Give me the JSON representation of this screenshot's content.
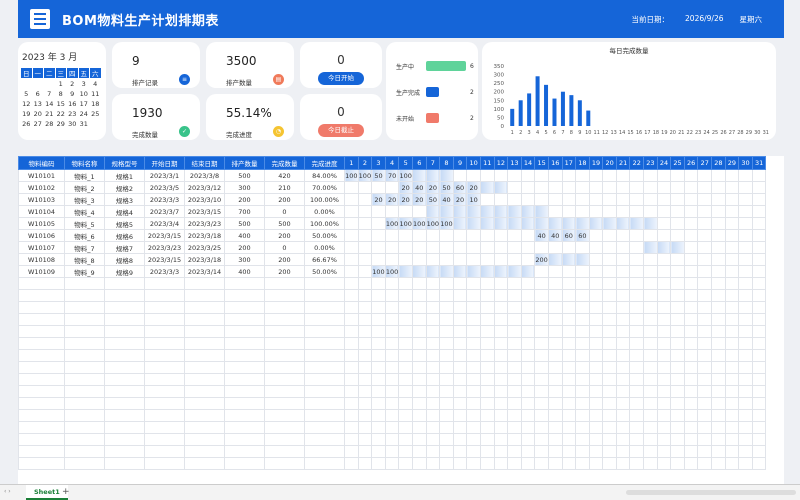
{
  "header": {
    "title": "BOM物料生产计划排期表",
    "date_label": "当前日期：",
    "date_value": "2026/9/26",
    "weekday": "星期六"
  },
  "calendar": {
    "title": "2023 年 3 月",
    "weekdays": [
      "日",
      "一",
      "二",
      "三",
      "四",
      "五",
      "六"
    ],
    "weeks": [
      [
        "",
        "",
        "",
        "1",
        "2",
        "3",
        "4"
      ],
      [
        "5",
        "6",
        "7",
        "8",
        "9",
        "10",
        "11"
      ],
      [
        "12",
        "13",
        "14",
        "15",
        "16",
        "17",
        "18"
      ],
      [
        "19",
        "20",
        "21",
        "22",
        "23",
        "24",
        "25"
      ],
      [
        "26",
        "27",
        "28",
        "29",
        "30",
        "31",
        ""
      ]
    ]
  },
  "stats": {
    "records": {
      "value": "9",
      "label": "排产记录",
      "color": "#1565d8",
      "icon": "records-icon"
    },
    "qty": {
      "value": "3500",
      "label": "排产数量",
      "color": "#f07a5a",
      "icon": "quantity-icon"
    },
    "done": {
      "value": "1930",
      "label": "完成数量",
      "color": "#39c38a",
      "icon": "done-icon"
    },
    "progress": {
      "value": "55.14%",
      "label": "完成进度",
      "color": "#f5c431",
      "icon": "progress-icon"
    }
  },
  "buttons": {
    "start_count": "0",
    "start_label": "今日开始",
    "end_count": "0",
    "end_label": "今日截止"
  },
  "status": [
    {
      "label": "生产中",
      "value": "6",
      "fraction": 1.0,
      "color": "#5fd39a"
    },
    {
      "label": "生产完成",
      "value": "2",
      "fraction": 0.33,
      "color": "#1565d8"
    },
    {
      "label": "未开始",
      "value": "2",
      "fraction": 0.33,
      "color": "#f07a6a"
    }
  ],
  "chart_data": {
    "type": "bar",
    "title": "每日完成数量",
    "categories": [
      "1",
      "2",
      "3",
      "4",
      "5",
      "6",
      "7",
      "8",
      "9",
      "10",
      "11",
      "12",
      "13",
      "14",
      "15",
      "16",
      "17",
      "18",
      "19",
      "20",
      "21",
      "22",
      "23",
      "24",
      "25",
      "26",
      "27",
      "28",
      "29",
      "30",
      "31"
    ],
    "values": [
      100,
      150,
      190,
      290,
      240,
      160,
      200,
      180,
      150,
      90,
      0,
      0,
      0,
      0,
      0,
      0,
      0,
      0,
      0,
      0,
      0,
      0,
      0,
      0,
      0,
      0,
      0,
      0,
      0,
      0,
      0
    ],
    "ylim": [
      0,
      350
    ],
    "yticks": [
      0,
      50,
      100,
      150,
      200,
      250,
      300,
      350
    ],
    "color": "#1565d8"
  },
  "chart_values": [
    100,
    150,
    190,
    290,
    240,
    160,
    200,
    180,
    150,
    90,
    0,
    0,
    0,
    0,
    0,
    0,
    0,
    0,
    0,
    0,
    0,
    0,
    0,
    0,
    0,
    0,
    0,
    0,
    0,
    0,
    0
  ],
  "grid": {
    "headers": [
      "物料编码",
      "物料名称",
      "规格型号",
      "开始日期",
      "结束日期",
      "排产数量",
      "完成数量",
      "完成进度"
    ],
    "days": [
      "1",
      "2",
      "3",
      "4",
      "5",
      "6",
      "7",
      "8",
      "9",
      "10",
      "11",
      "12",
      "13",
      "14",
      "15",
      "16",
      "17",
      "18",
      "19",
      "20",
      "21",
      "22",
      "23",
      "24",
      "25",
      "26",
      "27",
      "28",
      "29",
      "30",
      "31"
    ],
    "rows": [
      {
        "cells": [
          "W10101",
          "物料_1",
          "规格1",
          "2023/3/1",
          "2023/3/8",
          "500",
          "420",
          "84.00%"
        ],
        "start": 1,
        "end": 8,
        "daily": {
          "1": "100",
          "2": "100",
          "3": "50",
          "4": "70",
          "5": "100"
        }
      },
      {
        "cells": [
          "W10102",
          "物料_2",
          "规格2",
          "2023/3/5",
          "2023/3/12",
          "300",
          "210",
          "70.00%"
        ],
        "start": 5,
        "end": 12,
        "daily": {
          "5": "20",
          "6": "40",
          "7": "20",
          "8": "50",
          "9": "60",
          "10": "20"
        }
      },
      {
        "cells": [
          "W10103",
          "物料_3",
          "规格3",
          "2023/3/3",
          "2023/3/10",
          "200",
          "200",
          "100.00%"
        ],
        "start": 3,
        "end": 10,
        "daily": {
          "3": "20",
          "4": "20",
          "5": "20",
          "6": "20",
          "7": "50",
          "8": "40",
          "9": "20",
          "10": "10"
        }
      },
      {
        "cells": [
          "W10104",
          "物料_4",
          "规格4",
          "2023/3/7",
          "2023/3/15",
          "700",
          "0",
          "0.00%"
        ],
        "start": 7,
        "end": 15,
        "daily": {}
      },
      {
        "cells": [
          "W10105",
          "物料_5",
          "规格5",
          "2023/3/4",
          "2023/3/23",
          "500",
          "500",
          "100.00%"
        ],
        "start": 4,
        "end": 23,
        "daily": {
          "4": "100",
          "5": "100",
          "6": "100",
          "7": "100",
          "8": "100"
        }
      },
      {
        "cells": [
          "W10106",
          "物料_6",
          "规格6",
          "2023/3/15",
          "2023/3/18",
          "400",
          "200",
          "50.00%"
        ],
        "start": 15,
        "end": 18,
        "daily": {
          "15": "40",
          "16": "40",
          "17": "60",
          "18": "60"
        }
      },
      {
        "cells": [
          "W10107",
          "物料_7",
          "规格7",
          "2023/3/23",
          "2023/3/25",
          "200",
          "0",
          "0.00%"
        ],
        "start": 23,
        "end": 25,
        "daily": {}
      },
      {
        "cells": [
          "W10108",
          "物料_8",
          "规格8",
          "2023/3/15",
          "2023/3/18",
          "300",
          "200",
          "66.67%"
        ],
        "start": 15,
        "end": 18,
        "daily": {
          "15": "200"
        }
      },
      {
        "cells": [
          "W10109",
          "物料_9",
          "规格9",
          "2023/3/3",
          "2023/3/14",
          "400",
          "200",
          "50.00%"
        ],
        "start": 3,
        "end": 14,
        "daily": {
          "3": "100",
          "4": "100"
        }
      }
    ]
  },
  "sheet": {
    "tab": "Sheet1",
    "add": "+",
    "nav": "‹ ›"
  }
}
